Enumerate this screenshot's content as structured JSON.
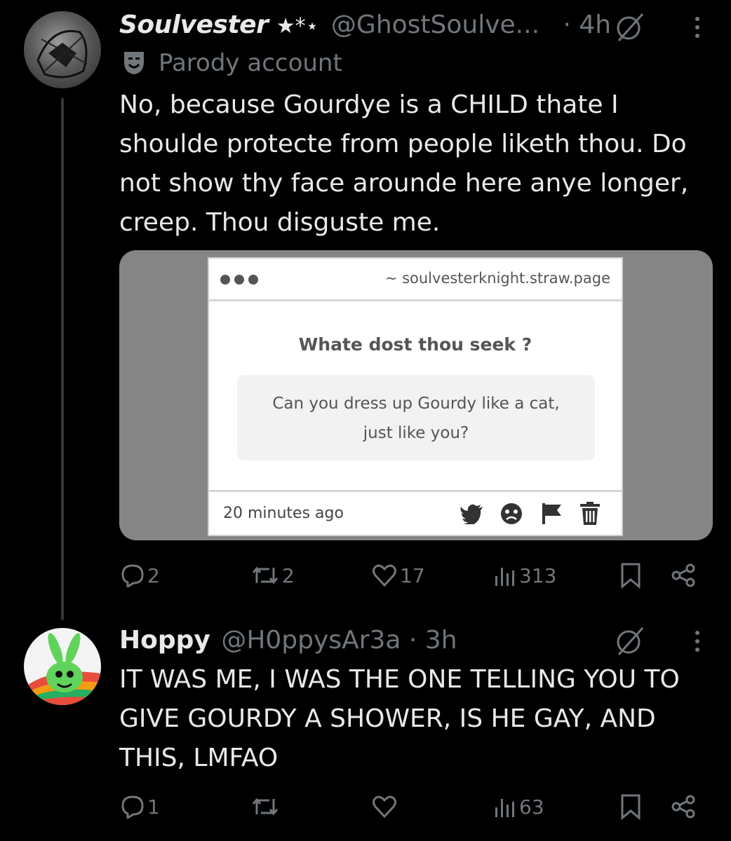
{
  "tweet1": {
    "display_name": "Soulvester",
    "name_symbols": "★*⋆",
    "handle": "@GhostSoulve...",
    "time": "· 4h",
    "label": "Parody account",
    "text_lines": [
      "No, because Gourdye is a CHILD thate I",
      "shoulde protecte from people liketh thou. Do",
      "not show thy face arounde here anye longer,",
      "creep. Thou disguste me."
    ],
    "card": {
      "url": "~ soulvesterknight.straw.page",
      "question_title": "Whate dost thou seek ?",
      "question_lines": [
        "Can you dress up Gourdy like a cat,",
        "just like you?"
      ],
      "posted": "20 minutes ago"
    },
    "stats": {
      "replies": "2",
      "reposts": "2",
      "likes": "17",
      "views": "313"
    }
  },
  "tweet2": {
    "display_name": "Hoppy",
    "handle": "@H0ppysAr3a",
    "time": "· 3h",
    "text_lines": [
      "IT WAS ME, I WAS THE ONE TELLING YOU TO",
      "GIVE GOURDY A SHOWER, IS HE GAY, AND",
      "THIS, LMFAO"
    ],
    "stats": {
      "replies": "1",
      "reposts": "",
      "likes": "",
      "views": "63"
    }
  },
  "colors": {
    "background": "#000000",
    "muted": "#71767b",
    "text": "#e7e9ea"
  }
}
